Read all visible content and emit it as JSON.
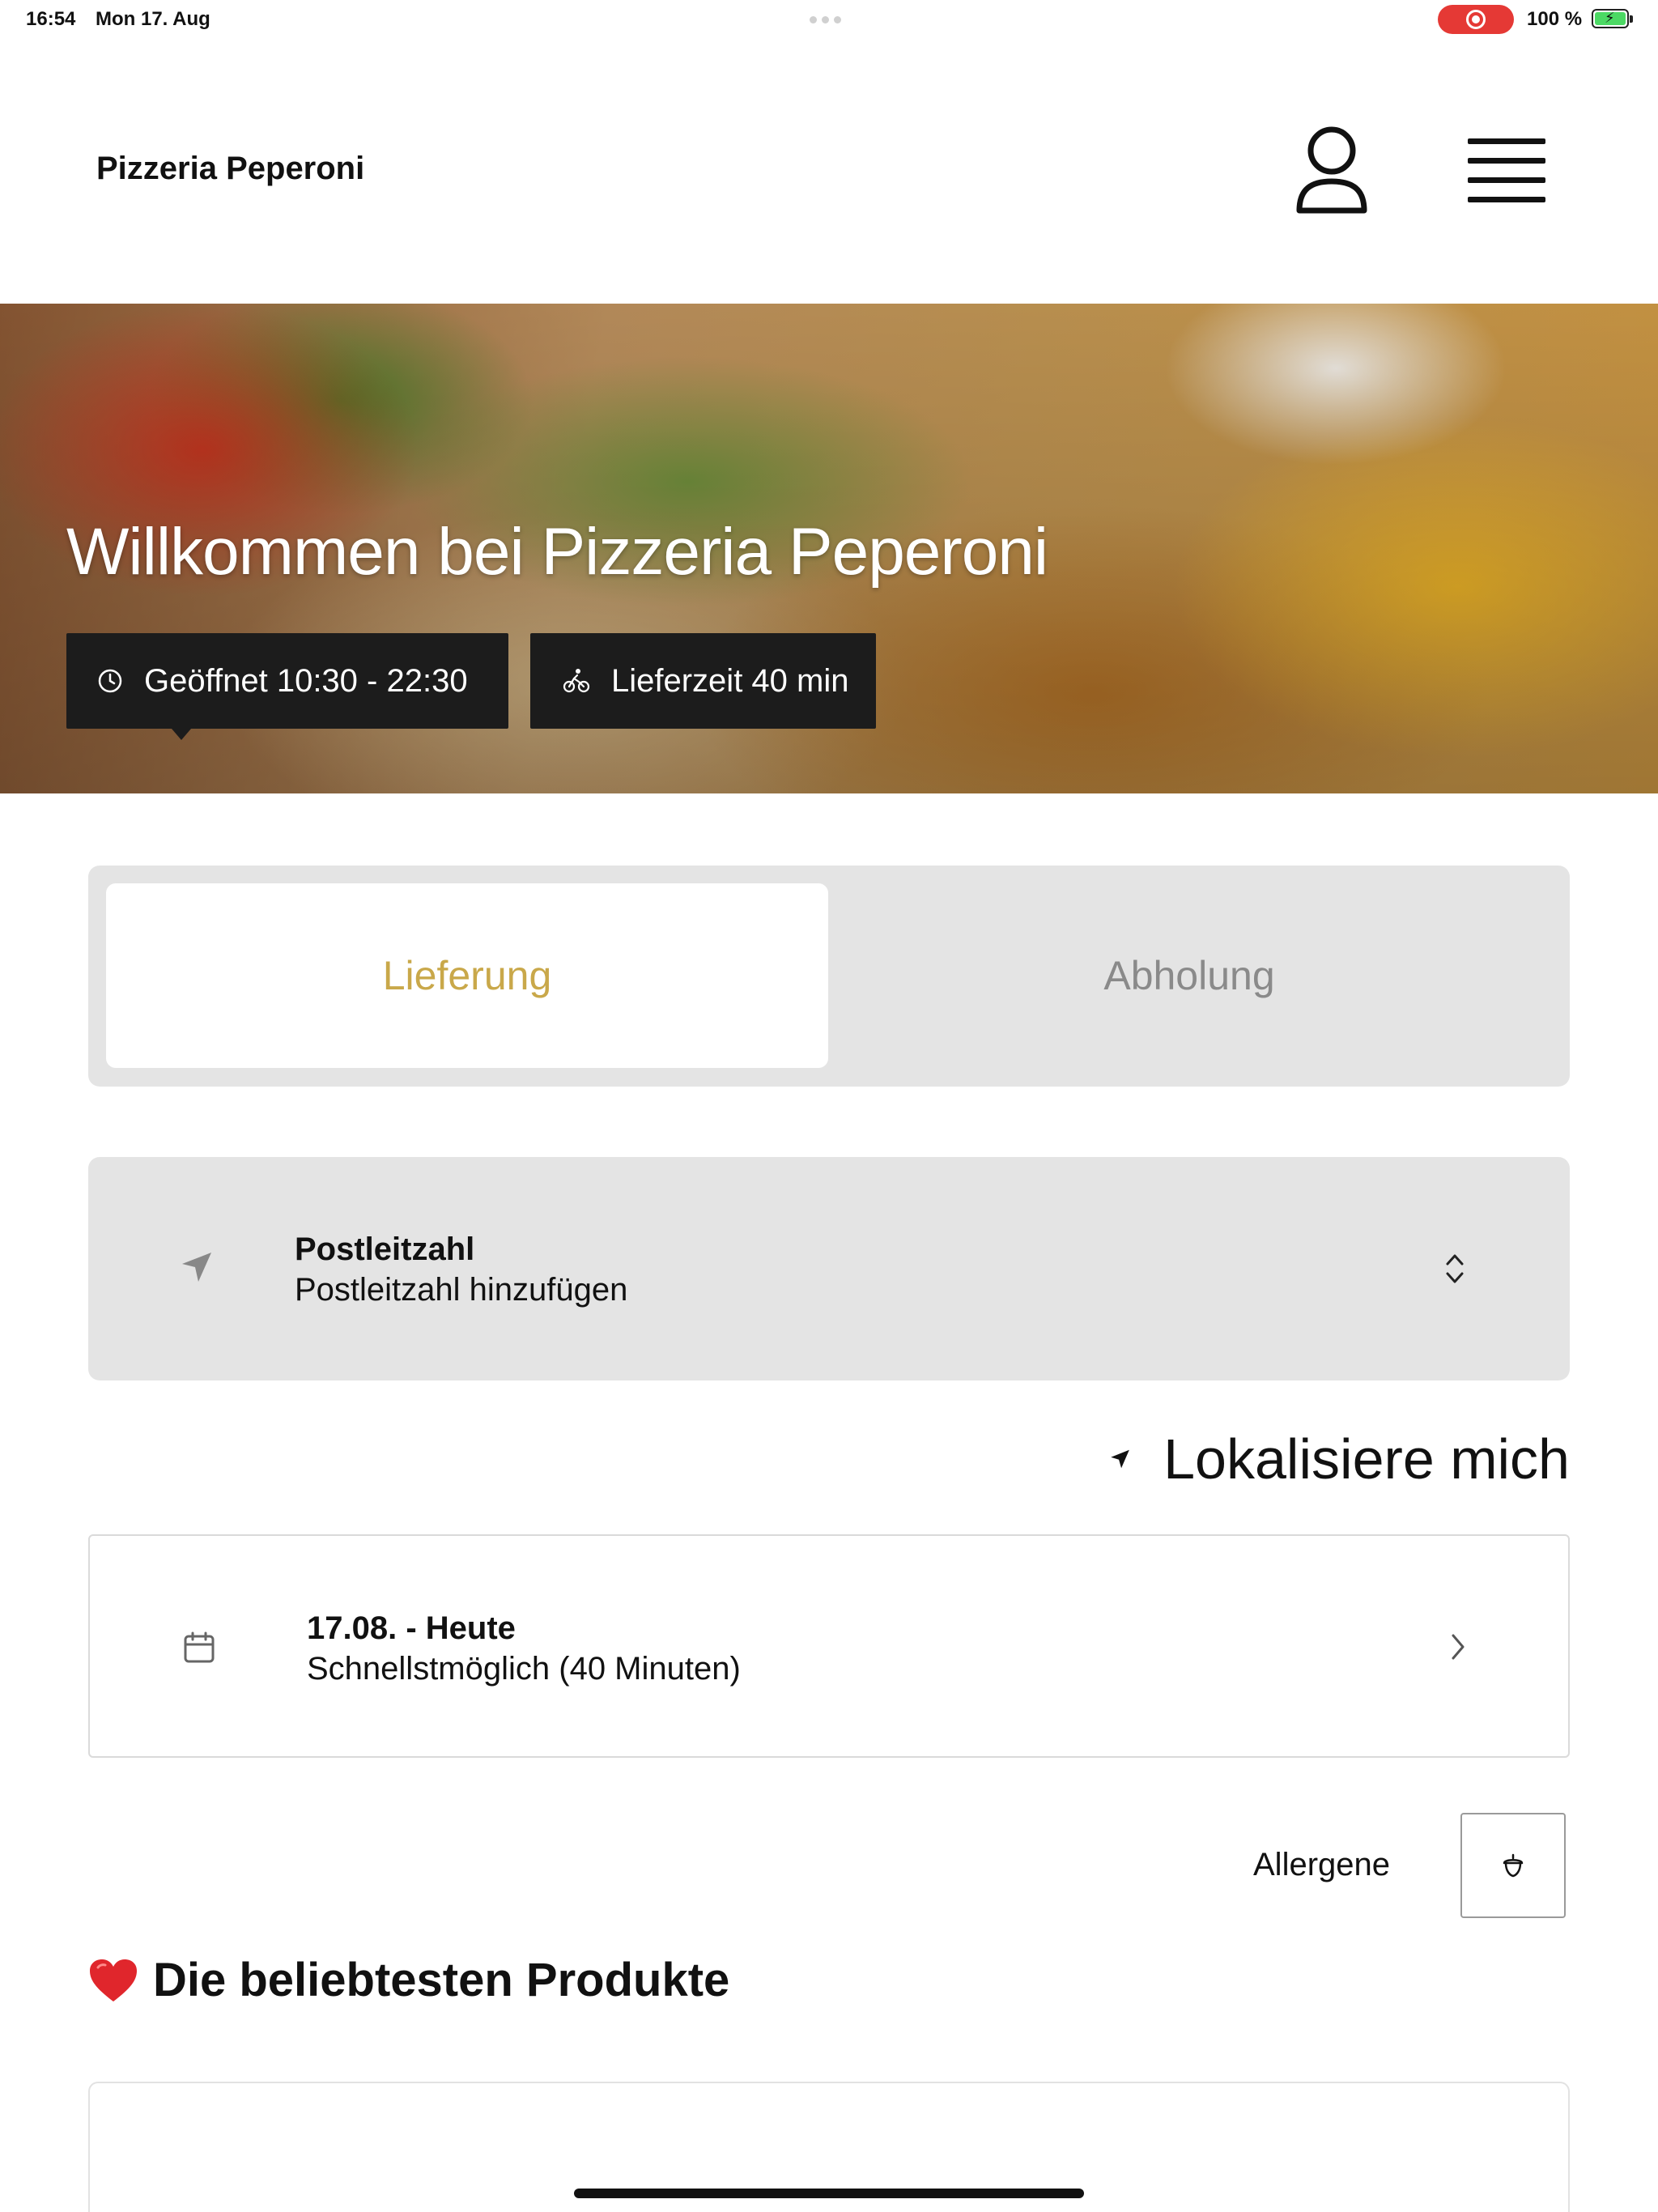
{
  "status_bar": {
    "time": "16:54",
    "date": "Mon 17. Aug",
    "battery_percent": "100 %",
    "battery_level": 1.0,
    "recording": true,
    "accent_recording": "#e53935",
    "battery_color": "#4cd964"
  },
  "header": {
    "brand": "Pizzeria Peperoni",
    "user_icon": "user-icon",
    "menu_icon": "hamburger-menu-icon"
  },
  "hero": {
    "title": "Willkommen bei Pizzeria Peperoni",
    "opening_hours": "Geöffnet 10:30 - 22:30",
    "delivery_time": "Lieferzeit 40 min",
    "opening_icon": "clock-icon",
    "delivery_icon": "bicycle-icon"
  },
  "order_mode": {
    "options": [
      "Lieferung",
      "Abholung"
    ],
    "selected": "Lieferung",
    "accent_color": "#c9a84a"
  },
  "postal_code": {
    "title": "Postleitzahl",
    "placeholder": "Postleitzahl hinzufügen",
    "icon": "location-arrow-icon",
    "chevron_icon": "chevron-up-down-icon"
  },
  "locate": {
    "label": "Lokalisiere mich",
    "icon": "location-arrow-icon"
  },
  "schedule": {
    "title": "17.08. - Heute",
    "subtitle": "Schnellstmöglich (40 Minuten)",
    "icon": "calendar-icon",
    "chevron_icon": "chevron-right-icon"
  },
  "allergens": {
    "label": "Allergene",
    "icon": "acorn-icon"
  },
  "popular": {
    "title": "Die beliebtesten Produkte",
    "icon": "heart-icon"
  }
}
